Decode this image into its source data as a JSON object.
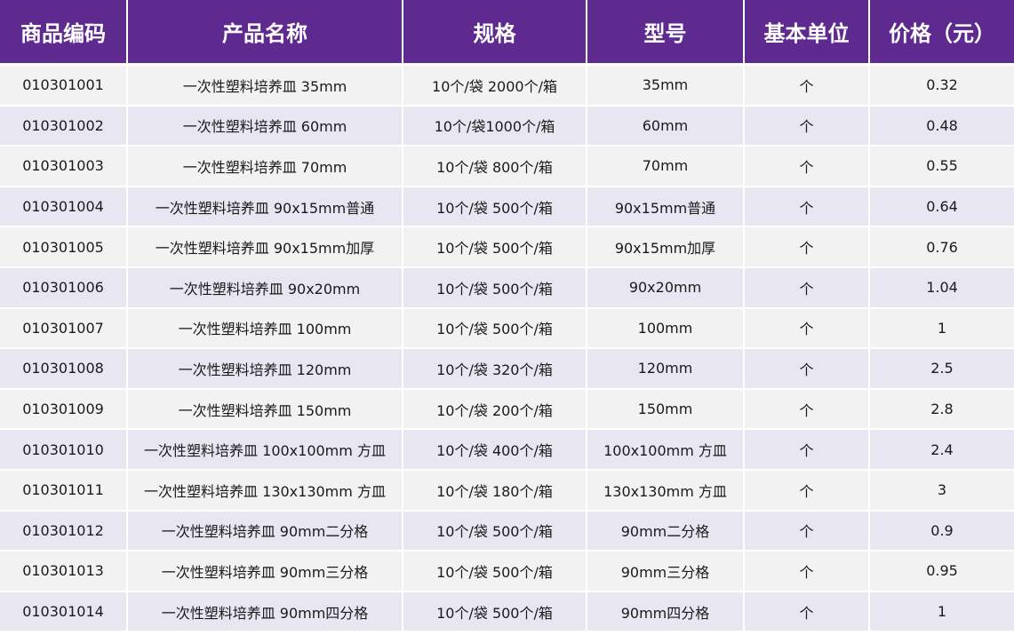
{
  "table": {
    "headers": [
      "商品编码",
      "产品名称",
      "规格",
      "型号",
      "基本单位",
      "价格（元）"
    ],
    "rows": [
      [
        "010301001",
        "一次性塑料培养皿 35mm",
        "10个/袋 2000个/箱",
        "35mm",
        "个",
        "0.32"
      ],
      [
        "010301002",
        "一次性塑料培养皿 60mm",
        "10个/袋1000个/箱",
        "60mm",
        "个",
        "0.48"
      ],
      [
        "010301003",
        "一次性塑料培养皿 70mm",
        "10个/袋 800个/箱",
        "70mm",
        "个",
        "0.55"
      ],
      [
        "010301004",
        "一次性塑料培养皿 90x15mm普通",
        "10个/袋 500个/箱",
        "90x15mm普通",
        "个",
        "0.64"
      ],
      [
        "010301005",
        "一次性塑料培养皿 90x15mm加厚",
        "10个/袋 500个/箱",
        "90x15mm加厚",
        "个",
        "0.76"
      ],
      [
        "010301006",
        "一次性塑料培养皿 90x20mm",
        "10个/袋 500个/箱",
        "90x20mm",
        "个",
        "1.04"
      ],
      [
        "010301007",
        "一次性塑料培养皿 100mm",
        "10个/袋 500个/箱",
        "100mm",
        "个",
        "1"
      ],
      [
        "010301008",
        "一次性塑料培养皿 120mm",
        "10个/袋 320个/箱",
        "120mm",
        "个",
        "2.5"
      ],
      [
        "010301009",
        "一次性塑料培养皿 150mm",
        "10个/袋 200个/箱",
        "150mm",
        "个",
        "2.8"
      ],
      [
        "010301010",
        "一次性塑料培养皿 100x100mm 方皿",
        "10个/袋 400个/箱",
        "100x100mm 方皿",
        "个",
        "2.4"
      ],
      [
        "010301011",
        "一次性塑料培养皿 130x130mm 方皿",
        "10个/袋 180个/箱",
        "130x130mm 方皿",
        "个",
        "3"
      ],
      [
        "010301012",
        "一次性塑料培养皿 90mm二分格",
        "10个/袋 500个/箱",
        "90mm二分格",
        "个",
        "0.9"
      ],
      [
        "010301013",
        "一次性塑料培养皿 90mm三分格",
        "10个/袋 500个/箱",
        "90mm三分格",
        "个",
        "0.95"
      ],
      [
        "010301014",
        "一次性塑料培养皿 90mm四分格",
        "10个/袋 500个/箱",
        "90mm四分格",
        "个",
        "1"
      ]
    ]
  },
  "colors": {
    "header_bg": "#5f2a8f",
    "header_text": "#ffffff",
    "row_odd": "#f2f2f2",
    "row_even": "#e8e6f1"
  }
}
